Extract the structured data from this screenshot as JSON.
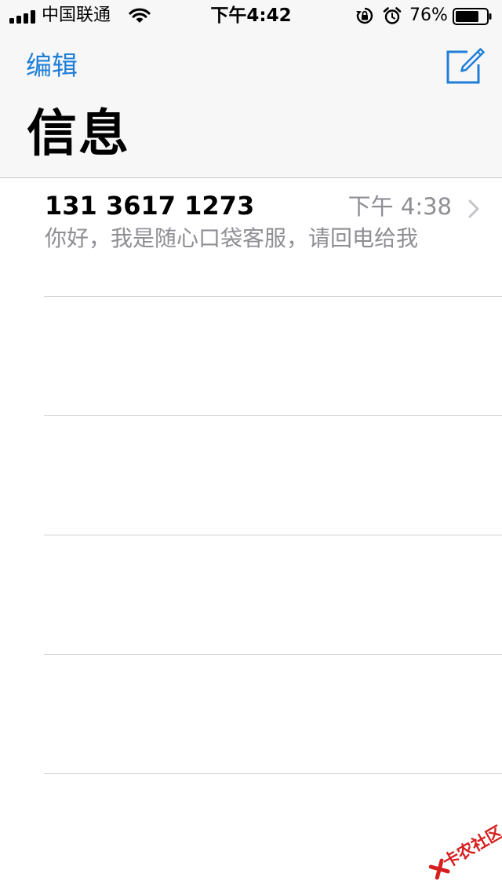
{
  "status_bar": {
    "carrier": "中国联通",
    "time": "下午4:42",
    "battery_percent": "76%",
    "battery_level": 0.76,
    "signal_icon": "signal-bars-icon",
    "wifi_icon": "wifi-icon",
    "rotation_lock_icon": "rotation-lock-icon",
    "alarm_icon": "alarm-icon",
    "battery_icon": "battery-icon"
  },
  "nav": {
    "edit_label": "编辑",
    "compose_icon": "compose-icon",
    "title": "信息"
  },
  "conversations": [
    {
      "name": "131 3617 1273",
      "time": "下午 4:38",
      "preview": "你好，我是随心口袋客服，请回电给我",
      "chevron_icon": "chevron-right-icon"
    }
  ],
  "watermark": {
    "text": "卡农社区"
  },
  "colors": {
    "accent": "#1f7fd8",
    "secondary_text": "#8e8e93",
    "bar_background": "#f7f7f7",
    "separator": "#d0d0d4",
    "watermark": "#d62020"
  }
}
